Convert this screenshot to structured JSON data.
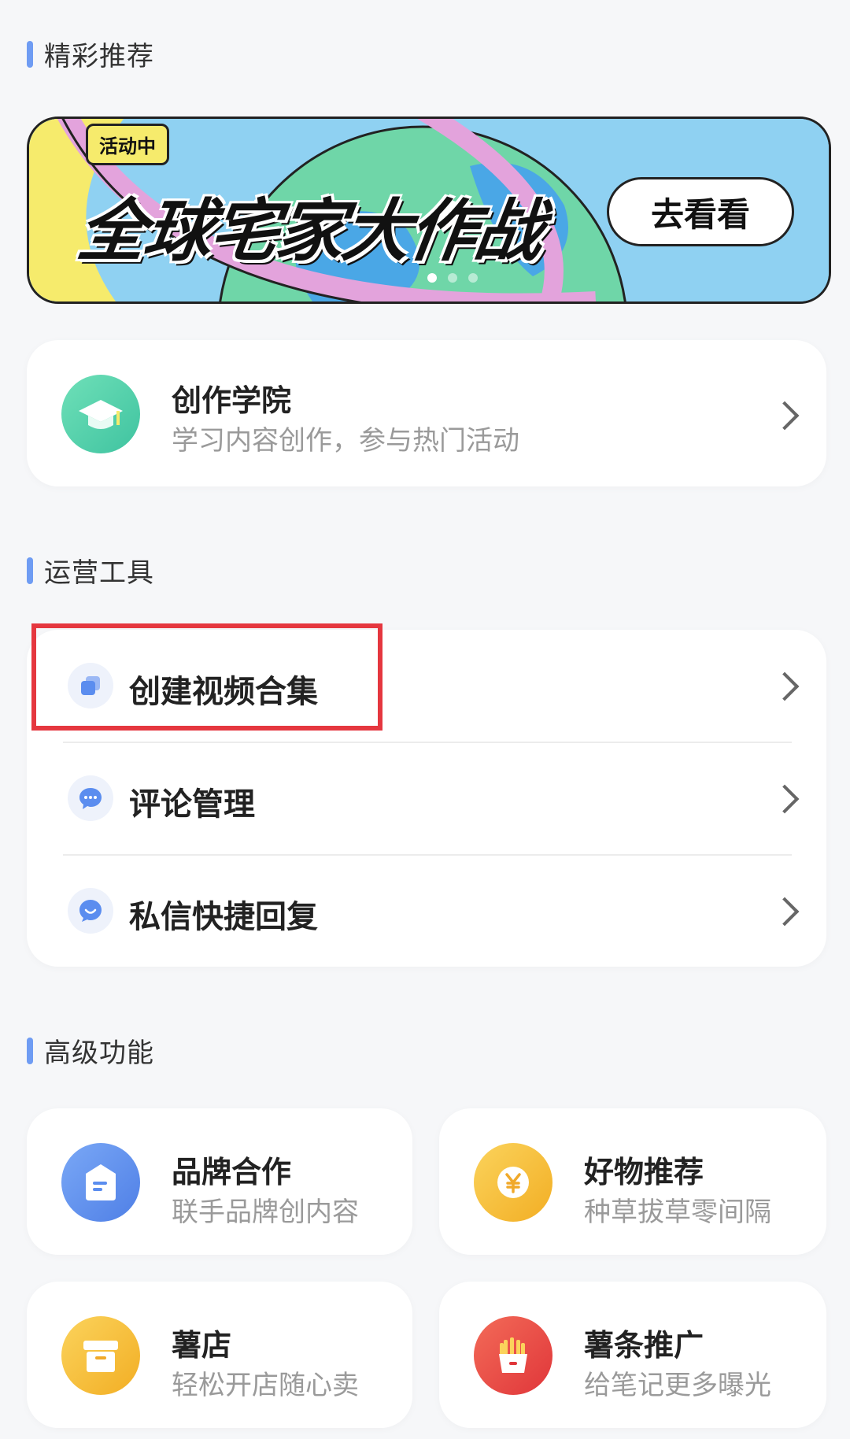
{
  "sections": {
    "featured": "精彩推荐",
    "ops_tools": "运营工具",
    "advanced": "高级功能"
  },
  "banner": {
    "badge": "活动中",
    "title": "全球宅家大作战",
    "button": "去看看",
    "dots": 3,
    "active_dot": 0,
    "colors": {
      "sky": "#8fd1f2",
      "earth": "#6fd6a8",
      "ring": "#e3a3dc",
      "yellow": "#f6eb6c"
    }
  },
  "academy": {
    "title": "创作学院",
    "subtitle": "学习内容创作，参与热门活动",
    "icon": "graduation-cap-icon"
  },
  "ops": [
    {
      "label": "创建视频合集",
      "icon": "collection-icon",
      "highlighted": true
    },
    {
      "label": "评论管理",
      "icon": "comment-icon",
      "highlighted": false
    },
    {
      "label": "私信快捷回复",
      "icon": "message-icon",
      "highlighted": false
    }
  ],
  "advanced": [
    {
      "title": "品牌合作",
      "subtitle": "联手品牌创内容",
      "icon": "brand-icon",
      "color": "#5b8def"
    },
    {
      "title": "好物推荐",
      "subtitle": "种草拔草零间隔",
      "icon": "yen-icon",
      "color": "#f5bd3c"
    },
    {
      "title": "薯店",
      "subtitle": "轻松开店随心卖",
      "icon": "store-box-icon",
      "color": "#f5bd3c"
    },
    {
      "title": "薯条推广",
      "subtitle": "给笔记更多曝光",
      "icon": "fries-icon",
      "color": "#e8443f"
    }
  ],
  "colors": {
    "accent_bar": "#6f9cf3",
    "highlight_border": "#e5373f",
    "icon_blue": "#5b8def"
  }
}
